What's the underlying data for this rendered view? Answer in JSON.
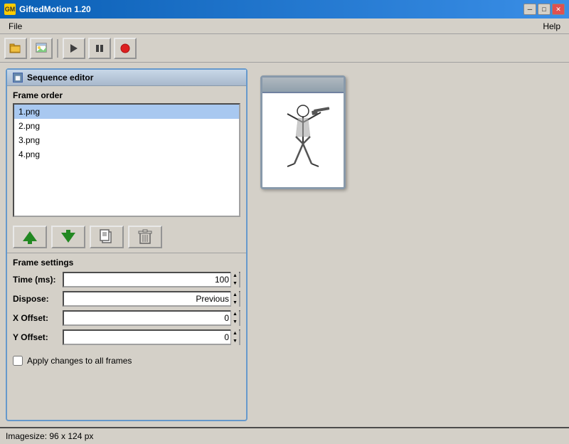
{
  "titlebar": {
    "title": "GiftedMotion 1.20",
    "icon_label": "GM",
    "min_button": "─",
    "max_button": "□",
    "close_button": "✕"
  },
  "menubar": {
    "file_label": "File",
    "help_label": "Help"
  },
  "toolbar": {
    "open_icon": "📁",
    "image_icon": "🖼",
    "play_icon": "▶",
    "pause_icon": "⏸",
    "record_icon": "⏺"
  },
  "left_panel": {
    "title": "Sequence editor",
    "frame_order_label": "Frame order",
    "frames": [
      {
        "name": "1.png",
        "selected": true
      },
      {
        "name": "2.png",
        "selected": false
      },
      {
        "name": "3.png",
        "selected": false
      },
      {
        "name": "4.png",
        "selected": false
      }
    ],
    "frame_settings_label": "Frame settings",
    "time_label": "Time (ms):",
    "time_value": "100",
    "dispose_label": "Dispose:",
    "dispose_value": "Previous",
    "x_offset_label": "X Offset:",
    "x_offset_value": "0",
    "y_offset_label": "Y Offset:",
    "y_offset_value": "0",
    "apply_changes_label": "Apply changes to all frames"
  },
  "status_bar": {
    "image_size": "Imagesize: 96 x 124 px"
  }
}
